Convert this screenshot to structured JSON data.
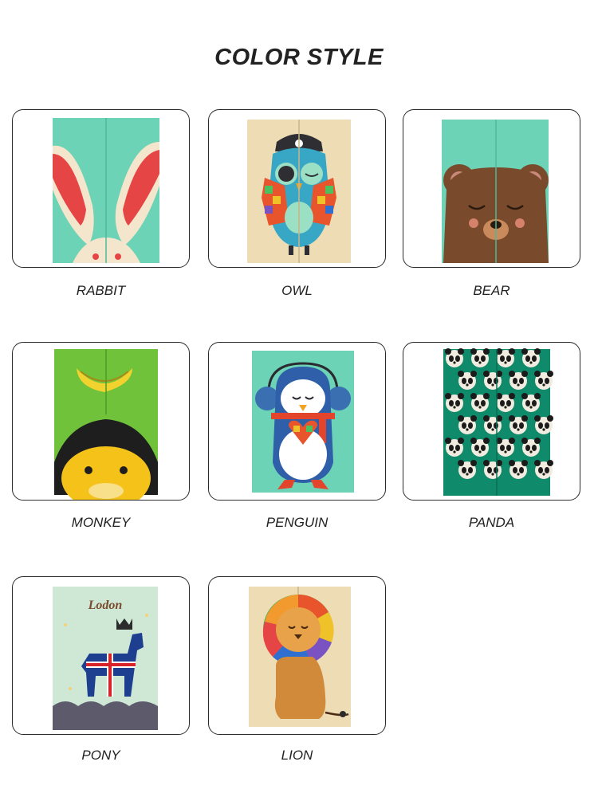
{
  "header": {
    "title": "COLOR STYLE"
  },
  "products": [
    {
      "label": "RABBIT"
    },
    {
      "label": "OWL"
    },
    {
      "label": "BEAR"
    },
    {
      "label": "MONKEY"
    },
    {
      "label": "PENGUIN"
    },
    {
      "label": "PANDA"
    },
    {
      "label": "PONY",
      "print_text": "Lodon"
    },
    {
      "label": "LION"
    }
  ],
  "colors": {
    "mint": "#6cd3b6",
    "linen": "#eedcb4",
    "bear_brown": "#7a4a2c",
    "lime_green": "#6fc23a",
    "panda_teal": "#0f8a6a",
    "text": "#222222"
  }
}
